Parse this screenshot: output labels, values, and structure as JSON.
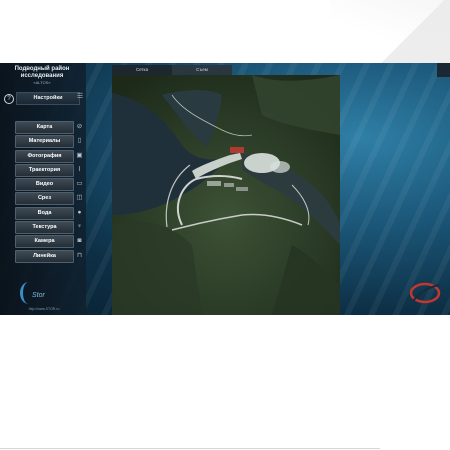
{
  "sidebar": {
    "title": "Подводный район исследования",
    "subtitle": "«ALTOS»",
    "settings_label": "Настройки",
    "menu": [
      {
        "label": "Карта",
        "icon": "compass-icon"
      },
      {
        "label": "Материалы",
        "icon": "documents-icon"
      },
      {
        "label": "Фотография",
        "icon": "photo-icon"
      },
      {
        "label": "Траектория",
        "icon": "trajectory-icon"
      },
      {
        "label": "Видео",
        "icon": "video-icon"
      },
      {
        "label": "Срез",
        "icon": "slice-icon"
      },
      {
        "label": "Вода",
        "icon": "water-drop-icon"
      },
      {
        "label": "Текстура",
        "icon": "texture-icon"
      },
      {
        "label": "Камера",
        "icon": "camera-icon"
      },
      {
        "label": "Линейка",
        "icon": "ruler-icon"
      }
    ],
    "logo_text": "Stor",
    "url": "http://www.STOR.ru"
  },
  "topbar": {
    "tabs": [
      "Сетка",
      "Съем"
    ]
  }
}
